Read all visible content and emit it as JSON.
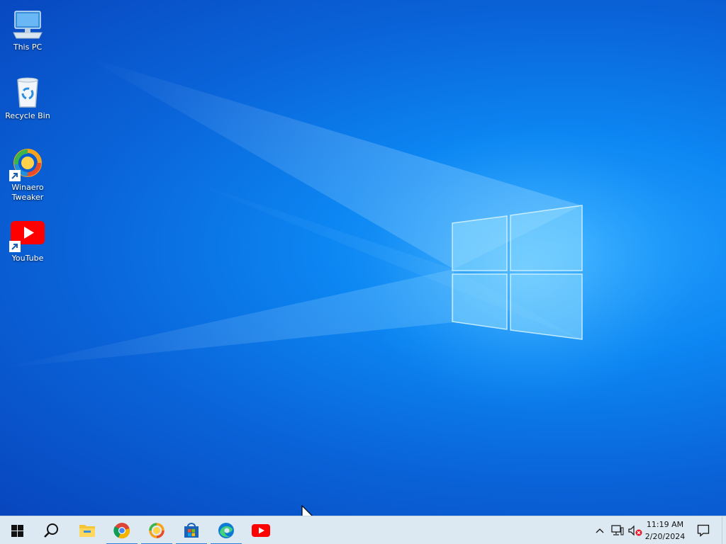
{
  "desktop": {
    "icons": [
      {
        "label": "This PC",
        "icon": "this-pc-icon"
      },
      {
        "label": "Recycle Bin",
        "icon": "recycle-bin-icon"
      },
      {
        "label_line1": "Winaero",
        "label_line2": "Tweaker",
        "icon": "winaero-tweaker-icon"
      },
      {
        "label": "YouTube",
        "icon": "youtube-icon"
      }
    ],
    "wallpaper": "windows-logo-light-beams",
    "accent_color": "#0a78e6"
  },
  "taskbar": {
    "start": "windows-start-icon",
    "search": "search-icon",
    "pinned": [
      {
        "name": "file-explorer",
        "running": false
      },
      {
        "name": "chrome",
        "running": true
      },
      {
        "name": "winaero-tweaker",
        "running": true
      },
      {
        "name": "microsoft-store",
        "running": true
      },
      {
        "name": "edge",
        "running": true
      },
      {
        "name": "youtube",
        "running": false
      }
    ],
    "tray": {
      "chevron": "show-hidden-icons",
      "network": "network-icon",
      "volume": "volume-muted-icon",
      "time": "11:19 AM",
      "date": "2/20/2024",
      "notifications": "action-center-icon"
    }
  }
}
